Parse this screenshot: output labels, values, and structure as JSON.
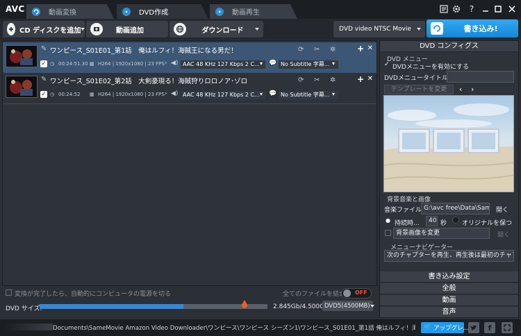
{
  "app": {
    "logo": "AVC"
  },
  "tabs": [
    {
      "label": "動画変換",
      "active": false
    },
    {
      "label": "DVD作成",
      "active": true
    },
    {
      "label": "動画再生",
      "active": false
    }
  ],
  "window_controls": {
    "help": "?"
  },
  "toolbar": {
    "add_disc": "CD ディスクを追加",
    "add_video": "動画追加",
    "download": "ダウンロード",
    "format": "DVD video NTSC Movie",
    "burn": "書き込み!"
  },
  "files": [
    {
      "title": "ワンピース_S01E01_第1話　俺はルフィ！海賊王になる男だ！",
      "duration": "00:24:51.30",
      "video": "H264 | 1920x1080 | 23 FPS",
      "audio": "AAC 48 KHz 127 Kbps 2 C...",
      "subtitle": "No Subtitle 字幕...",
      "checked": true,
      "selected": true
    },
    {
      "title": "ワンピース_S01E02_第2話　大剣豪現る！海賊狩りロロノア･ゾロ",
      "duration": "00:24:52",
      "video": "H264 | 1920x1080 | 23 FPS",
      "audio": "AAC 48 KHz 127 Kbps 2 C...",
      "subtitle": "No Subtitle 字幕...",
      "checked": true,
      "selected": false
    }
  ],
  "bottom": {
    "shutdown_label": "変換が完了したら、自動的にコンピュータの電源を切る",
    "merge_label": "全てのファイルを結合",
    "merge_toggle": "OFF",
    "dvd_size_label": "DVD サイズ:",
    "size_readout": "2.845Gb/4.500Gb",
    "disc_type": "DVD5(4500MB)",
    "usage_fraction": 0.632
  },
  "dvd_config": {
    "header": "DVD コンフィグス",
    "menu_group": "DVD メニュー",
    "enable_menu": "DVDメニューを有効にする",
    "menu_title_label": "DVDメニュータイトル",
    "menu_title_value": "",
    "change_template": "テンプレートを変更",
    "bgm_group": "背景音楽と画像",
    "music_file_label": "音楽ファイル",
    "music_file_value": "G:\\avc free\\Data\\Sampl",
    "open": "開く",
    "duration_label": "持続時...",
    "duration_value": "40",
    "seconds": "秒",
    "keep_original": "オリジナルを保つ",
    "bg_image_label": "背景画像を変更",
    "open2": "開く",
    "navigator_group": "メニューナビゲーター",
    "navigator_value": "次のチャプターを再生、再生後は最初のチャプ",
    "sections": [
      "書き込み設定",
      "全般",
      "動画",
      "音声"
    ]
  },
  "statusbar": {
    "path": "Documents\\SameMovie Amazon Video Downloader\\ワンピース\\ワンピース シーズン1\\ワンピース_S01E01_第1話 俺はルフィ！海賊王にな",
    "upgrade": "アップグレ..."
  },
  "colors": {
    "accent": "#1e9bef",
    "selected_row": "#3c5675",
    "progress": "#3a86d0"
  }
}
